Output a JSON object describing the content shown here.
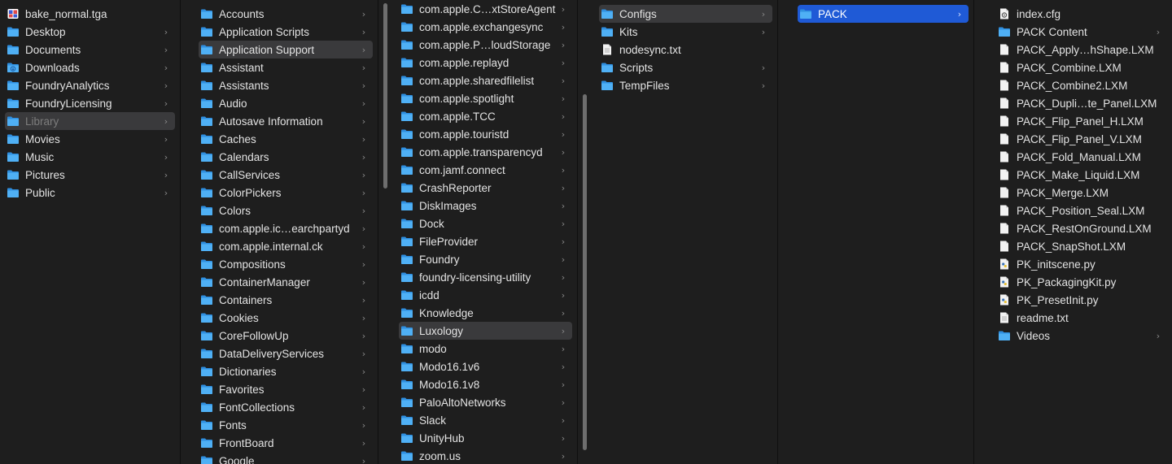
{
  "columns": [
    {
      "id": "home",
      "items": [
        {
          "label": "bake_normal.tga",
          "icon": "image-file-icon",
          "arrow": false
        },
        {
          "label": "Desktop",
          "icon": "folder-icon",
          "arrow": true
        },
        {
          "label": "Documents",
          "icon": "folder-icon",
          "arrow": true
        },
        {
          "label": "Downloads",
          "icon": "downloads-folder-icon",
          "arrow": true
        },
        {
          "label": "FoundryAnalytics",
          "icon": "folder-icon",
          "arrow": true
        },
        {
          "label": "FoundryLicensing",
          "icon": "folder-icon",
          "arrow": true
        },
        {
          "label": "Library",
          "icon": "folder-icon",
          "arrow": true,
          "state": "selected-gray",
          "dim": true
        },
        {
          "label": "Movies",
          "icon": "folder-icon",
          "arrow": true
        },
        {
          "label": "Music",
          "icon": "folder-icon",
          "arrow": true
        },
        {
          "label": "Pictures",
          "icon": "folder-icon",
          "arrow": true
        },
        {
          "label": "Public",
          "icon": "folder-icon",
          "arrow": true
        }
      ]
    },
    {
      "id": "library",
      "items": [
        {
          "label": "Accounts",
          "icon": "folder-icon",
          "arrow": true
        },
        {
          "label": "Application Scripts",
          "icon": "folder-icon",
          "arrow": true
        },
        {
          "label": "Application Support",
          "icon": "folder-icon",
          "arrow": true,
          "state": "selected-gray"
        },
        {
          "label": "Assistant",
          "icon": "folder-icon",
          "arrow": true
        },
        {
          "label": "Assistants",
          "icon": "folder-icon",
          "arrow": true
        },
        {
          "label": "Audio",
          "icon": "folder-icon",
          "arrow": true
        },
        {
          "label": "Autosave Information",
          "icon": "folder-icon",
          "arrow": true
        },
        {
          "label": "Caches",
          "icon": "folder-icon",
          "arrow": true
        },
        {
          "label": "Calendars",
          "icon": "folder-icon",
          "arrow": true
        },
        {
          "label": "CallServices",
          "icon": "folder-icon",
          "arrow": true
        },
        {
          "label": "ColorPickers",
          "icon": "folder-icon",
          "arrow": true
        },
        {
          "label": "Colors",
          "icon": "folder-icon",
          "arrow": true
        },
        {
          "label": "com.apple.ic…earchpartyd",
          "icon": "folder-icon",
          "arrow": true
        },
        {
          "label": "com.apple.internal.ck",
          "icon": "folder-icon",
          "arrow": true
        },
        {
          "label": "Compositions",
          "icon": "folder-icon",
          "arrow": true
        },
        {
          "label": "ContainerManager",
          "icon": "folder-icon",
          "arrow": true
        },
        {
          "label": "Containers",
          "icon": "folder-icon",
          "arrow": true
        },
        {
          "label": "Cookies",
          "icon": "folder-icon",
          "arrow": true
        },
        {
          "label": "CoreFollowUp",
          "icon": "folder-icon",
          "arrow": true
        },
        {
          "label": "DataDeliveryServices",
          "icon": "folder-icon",
          "arrow": true
        },
        {
          "label": "Dictionaries",
          "icon": "folder-icon",
          "arrow": true
        },
        {
          "label": "Favorites",
          "icon": "folder-icon",
          "arrow": true
        },
        {
          "label": "FontCollections",
          "icon": "folder-icon",
          "arrow": true
        },
        {
          "label": "Fonts",
          "icon": "folder-icon",
          "arrow": true
        },
        {
          "label": "FrontBoard",
          "icon": "folder-icon",
          "arrow": true
        },
        {
          "label": "Google",
          "icon": "folder-icon",
          "arrow": true
        }
      ]
    },
    {
      "id": "application-support",
      "items": [
        {
          "label": "com.apple.C…xtStoreAgent",
          "icon": "folder-icon",
          "arrow": true
        },
        {
          "label": "com.apple.exchangesync",
          "icon": "folder-icon",
          "arrow": true
        },
        {
          "label": "com.apple.P…loudStorage",
          "icon": "folder-icon",
          "arrow": true
        },
        {
          "label": "com.apple.replayd",
          "icon": "folder-icon",
          "arrow": true
        },
        {
          "label": "com.apple.sharedfilelist",
          "icon": "folder-icon",
          "arrow": true
        },
        {
          "label": "com.apple.spotlight",
          "icon": "folder-icon",
          "arrow": true
        },
        {
          "label": "com.apple.TCC",
          "icon": "folder-icon",
          "arrow": true
        },
        {
          "label": "com.apple.touristd",
          "icon": "folder-icon",
          "arrow": true
        },
        {
          "label": "com.apple.transparencyd",
          "icon": "folder-icon",
          "arrow": true
        },
        {
          "label": "com.jamf.connect",
          "icon": "folder-icon",
          "arrow": true
        },
        {
          "label": "CrashReporter",
          "icon": "folder-icon",
          "arrow": true
        },
        {
          "label": "DiskImages",
          "icon": "folder-icon",
          "arrow": true
        },
        {
          "label": "Dock",
          "icon": "folder-icon",
          "arrow": true
        },
        {
          "label": "FileProvider",
          "icon": "folder-icon",
          "arrow": true
        },
        {
          "label": "Foundry",
          "icon": "folder-icon",
          "arrow": true
        },
        {
          "label": "foundry-licensing-utility",
          "icon": "folder-icon",
          "arrow": true
        },
        {
          "label": "icdd",
          "icon": "folder-icon",
          "arrow": true
        },
        {
          "label": "Knowledge",
          "icon": "folder-icon",
          "arrow": true
        },
        {
          "label": "Luxology",
          "icon": "folder-icon",
          "arrow": true,
          "state": "selected-gray"
        },
        {
          "label": "modo",
          "icon": "folder-icon",
          "arrow": true
        },
        {
          "label": "Modo16.1v6",
          "icon": "folder-icon",
          "arrow": true
        },
        {
          "label": "Modo16.1v8",
          "icon": "folder-icon",
          "arrow": true
        },
        {
          "label": "PaloAltoNetworks",
          "icon": "folder-icon",
          "arrow": true
        },
        {
          "label": "Slack",
          "icon": "folder-icon",
          "arrow": true
        },
        {
          "label": "UnityHub",
          "icon": "folder-icon",
          "arrow": true
        },
        {
          "label": "zoom.us",
          "icon": "folder-icon",
          "arrow": true
        }
      ]
    },
    {
      "id": "luxology",
      "items": [
        {
          "label": "Configs",
          "icon": "folder-icon",
          "arrow": true,
          "state": "selected-gray"
        },
        {
          "label": "Kits",
          "icon": "folder-icon",
          "arrow": true
        },
        {
          "label": "nodesync.txt",
          "icon": "text-file-icon",
          "arrow": false
        },
        {
          "label": "Scripts",
          "icon": "folder-icon",
          "arrow": true
        },
        {
          "label": "TempFiles",
          "icon": "folder-icon",
          "arrow": true
        }
      ]
    },
    {
      "id": "configs",
      "items": [
        {
          "label": "PACK",
          "icon": "folder-icon",
          "arrow": true,
          "state": "selected-blue"
        }
      ]
    },
    {
      "id": "pack",
      "items": [
        {
          "label": "index.cfg",
          "icon": "config-file-icon",
          "arrow": false
        },
        {
          "label": "PACK Content",
          "icon": "folder-icon",
          "arrow": true
        },
        {
          "label": "PACK_Apply…hShape.LXM",
          "icon": "document-file-icon",
          "arrow": false
        },
        {
          "label": "PACK_Combine.LXM",
          "icon": "document-file-icon",
          "arrow": false
        },
        {
          "label": "PACK_Combine2.LXM",
          "icon": "document-file-icon",
          "arrow": false
        },
        {
          "label": "PACK_Dupli…te_Panel.LXM",
          "icon": "document-file-icon",
          "arrow": false
        },
        {
          "label": "PACK_Flip_Panel_H.LXM",
          "icon": "document-file-icon",
          "arrow": false
        },
        {
          "label": "PACK_Flip_Panel_V.LXM",
          "icon": "document-file-icon",
          "arrow": false
        },
        {
          "label": "PACK_Fold_Manual.LXM",
          "icon": "document-file-icon",
          "arrow": false
        },
        {
          "label": "PACK_Make_Liquid.LXM",
          "icon": "document-file-icon",
          "arrow": false
        },
        {
          "label": "PACK_Merge.LXM",
          "icon": "document-file-icon",
          "arrow": false
        },
        {
          "label": "PACK_Position_Seal.LXM",
          "icon": "document-file-icon",
          "arrow": false
        },
        {
          "label": "PACK_RestOnGround.LXM",
          "icon": "document-file-icon",
          "arrow": false
        },
        {
          "label": "PACK_SnapShot.LXM",
          "icon": "document-file-icon",
          "arrow": false
        },
        {
          "label": "PK_initscene.py",
          "icon": "python-file-icon",
          "arrow": false
        },
        {
          "label": "PK_PackagingKit.py",
          "icon": "python-file-icon",
          "arrow": false
        },
        {
          "label": "PK_PresetInit.py",
          "icon": "python-file-icon",
          "arrow": false
        },
        {
          "label": "readme.txt",
          "icon": "text-file-icon",
          "arrow": false
        },
        {
          "label": "Videos",
          "icon": "folder-icon",
          "arrow": true
        }
      ]
    }
  ],
  "colors": {
    "folder": "#3aa0ef",
    "selected_blue": "#1f5ad6",
    "selected_gray": "#3a3a3c",
    "background": "#1e1e1e"
  }
}
